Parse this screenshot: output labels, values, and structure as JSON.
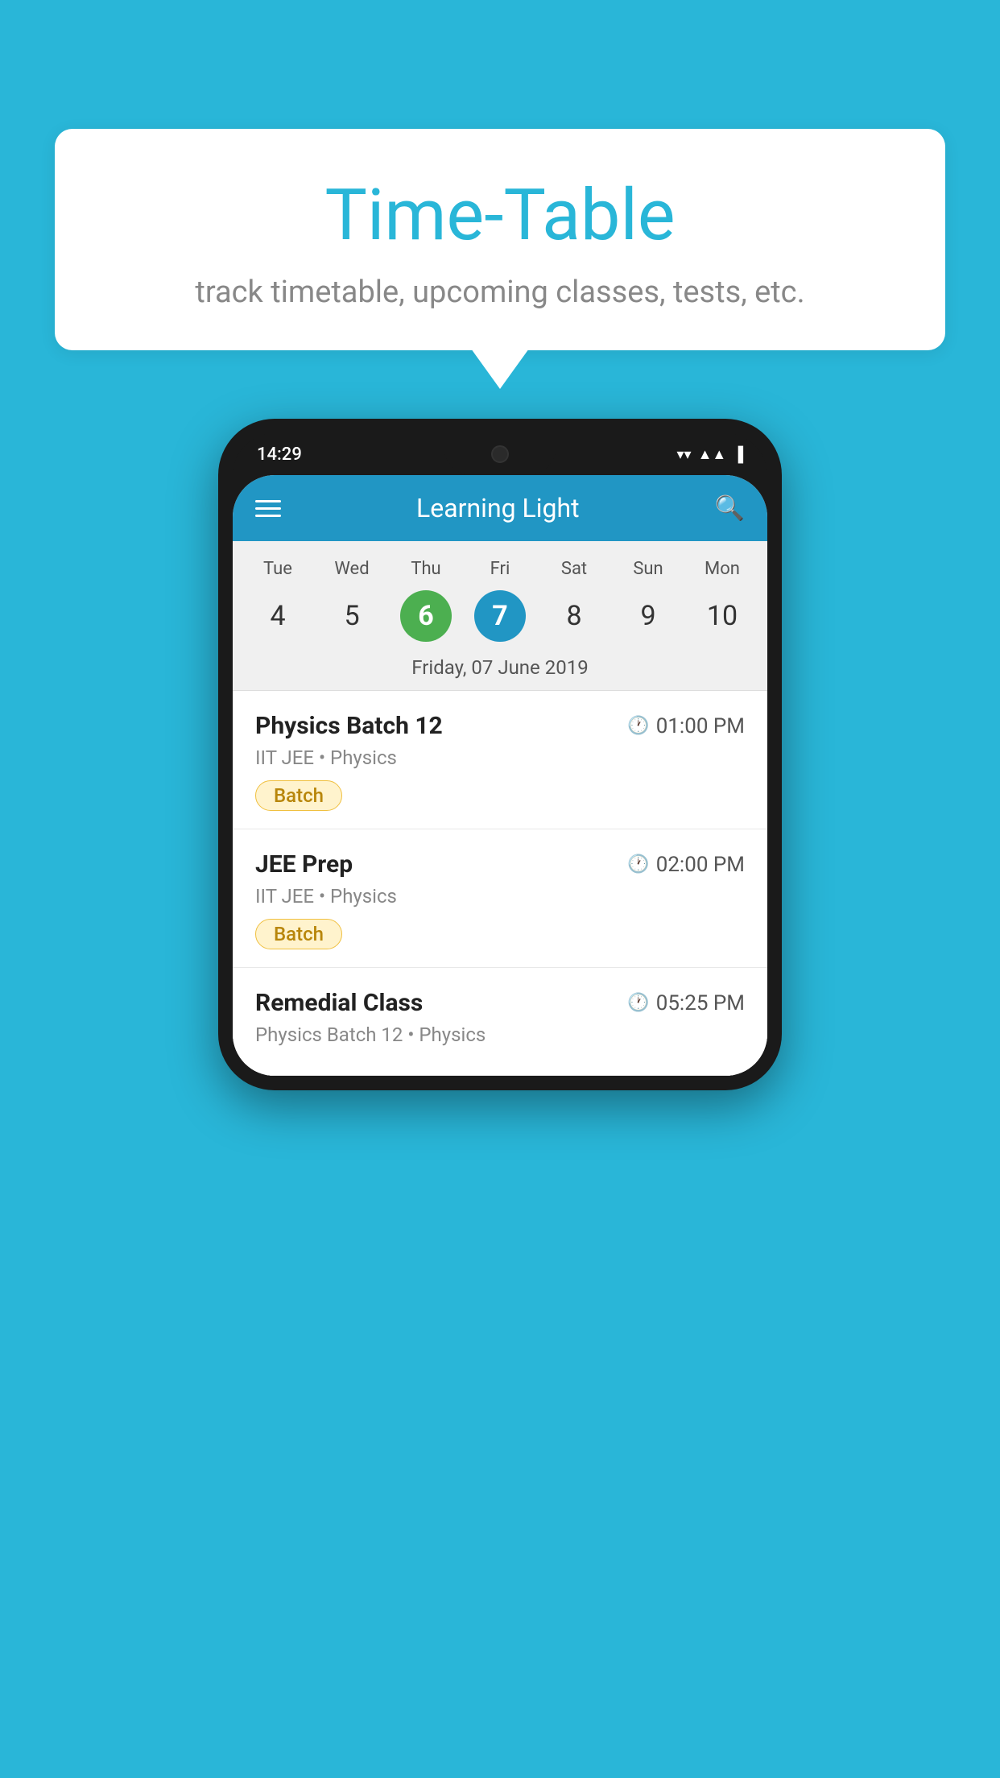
{
  "background": {
    "color": "#29B6D8"
  },
  "speech_bubble": {
    "title": "Time-Table",
    "subtitle": "track timetable, upcoming classes, tests, etc."
  },
  "phone": {
    "status_bar": {
      "time": "14:29"
    },
    "app_bar": {
      "title": "Learning Light",
      "menu_icon_label": "menu",
      "search_icon_label": "search"
    },
    "calendar": {
      "days": [
        {
          "name": "Tue",
          "num": "4",
          "state": "normal"
        },
        {
          "name": "Wed",
          "num": "5",
          "state": "normal"
        },
        {
          "name": "Thu",
          "num": "6",
          "state": "today"
        },
        {
          "name": "Fri",
          "num": "7",
          "state": "selected"
        },
        {
          "name": "Sat",
          "num": "8",
          "state": "normal"
        },
        {
          "name": "Sun",
          "num": "9",
          "state": "normal"
        },
        {
          "name": "Mon",
          "num": "10",
          "state": "normal"
        }
      ],
      "selected_date_label": "Friday, 07 June 2019"
    },
    "classes": [
      {
        "name": "Physics Batch 12",
        "time": "01:00 PM",
        "meta": "IIT JEE • Physics",
        "badge": "Batch"
      },
      {
        "name": "JEE Prep",
        "time": "02:00 PM",
        "meta": "IIT JEE • Physics",
        "badge": "Batch"
      },
      {
        "name": "Remedial Class",
        "time": "05:25 PM",
        "meta": "Physics Batch 12 • Physics",
        "badge": null
      }
    ]
  }
}
